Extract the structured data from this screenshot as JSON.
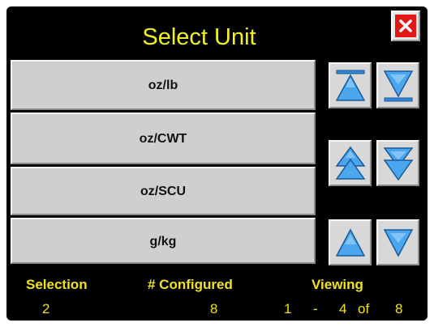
{
  "dialog": {
    "title": "Select Unit",
    "close_icon": "close-x-icon"
  },
  "units": [
    {
      "label": "oz/lb"
    },
    {
      "label": "oz/CWT"
    },
    {
      "label": "oz/SCU"
    },
    {
      "label": "g/kg"
    }
  ],
  "navigation": {
    "first_icon": "scroll-to-top-icon",
    "last_icon": "scroll-to-bottom-icon",
    "page_up_icon": "page-up-icon",
    "page_down_icon": "page-down-icon",
    "up_icon": "up-arrow-icon",
    "down_icon": "down-arrow-icon"
  },
  "footer": {
    "selection_label": "Selection",
    "selection_value": "2",
    "configured_label": "# Configured",
    "configured_value": "8",
    "viewing_label": "Viewing",
    "viewing_start": "1",
    "viewing_dash": "-",
    "viewing_end": "4",
    "viewing_of": "of",
    "viewing_total": "8"
  },
  "colors": {
    "background": "#000000",
    "title_text": "#f2f21c",
    "footer_text": "#f2e21c",
    "button_face": "#cfcfcf",
    "close_red": "#e31616",
    "arrow_blue": "#4aa6ee"
  }
}
